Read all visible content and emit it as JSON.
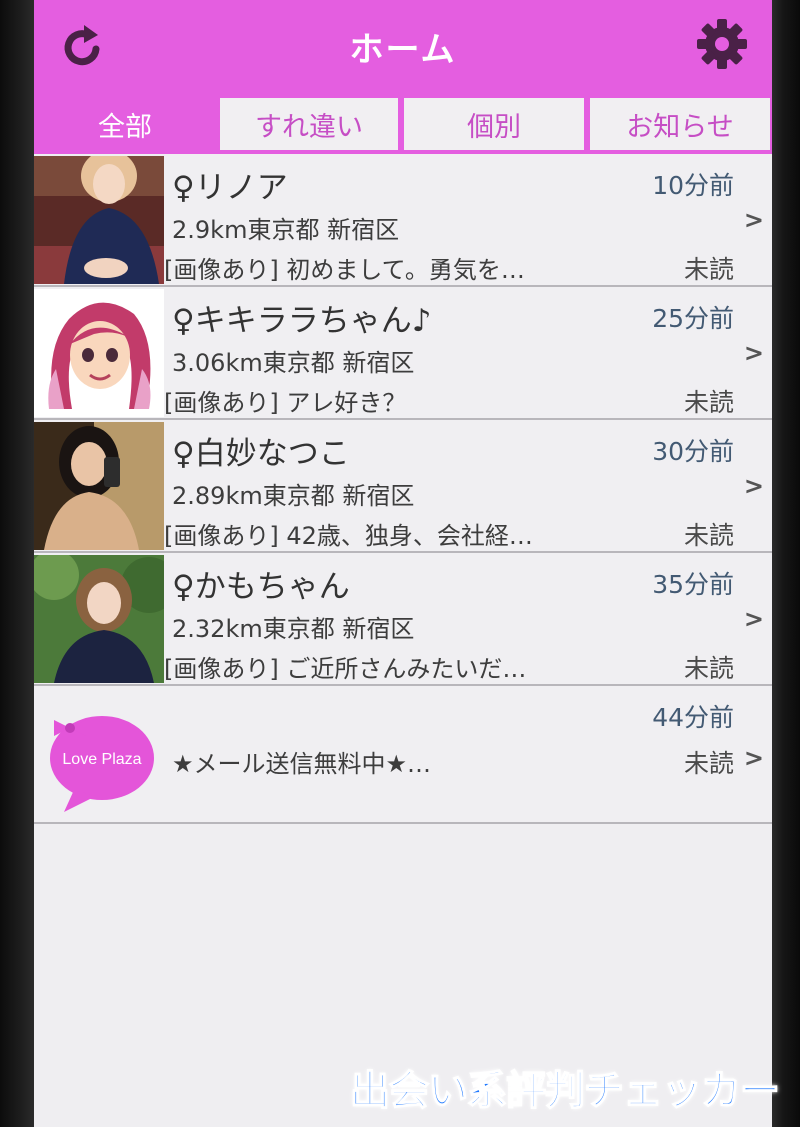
{
  "header": {
    "title": "ホーム",
    "refresh_icon": "refresh-icon",
    "settings_icon": "gear-icon"
  },
  "tabs": [
    {
      "label": "全部",
      "active": true
    },
    {
      "label": "すれ違い",
      "active": false
    },
    {
      "label": "個別",
      "active": false
    },
    {
      "label": "お知らせ",
      "active": false
    }
  ],
  "messages": [
    {
      "name": "♀リノア",
      "time": "10分前",
      "location": "2.9km東京都 新宿区",
      "preview": "[画像あり] 初めまして。勇気を…",
      "status": "未読"
    },
    {
      "name": "♀キキララちゃん♪",
      "time": "25分前",
      "location": "3.06km東京都 新宿区",
      "preview": "[画像あり] アレ好き？",
      "status": "未読"
    },
    {
      "name": "♀白妙なつこ",
      "time": "30分前",
      "location": "2.89km東京都 新宿区",
      "preview": "[画像あり] 42歳、独身、会社経…",
      "status": "未読"
    },
    {
      "name": "♀かもちゃん",
      "time": "35分前",
      "location": "2.32km東京都 新宿区",
      "preview": "[画像あり] ご近所さんみたいだ…",
      "status": "未読"
    }
  ],
  "notice": {
    "logo_text": "Love Plaza",
    "time": "44分前",
    "preview": "★メール送信無料中★…",
    "status": "未読"
  },
  "chevron": ">",
  "watermark": "出会い系評判チェッカー",
  "colors": {
    "accent": "#e45ee0",
    "tab_text": "#c64ec5",
    "time_text": "#435a73",
    "background": "#efeef1"
  }
}
